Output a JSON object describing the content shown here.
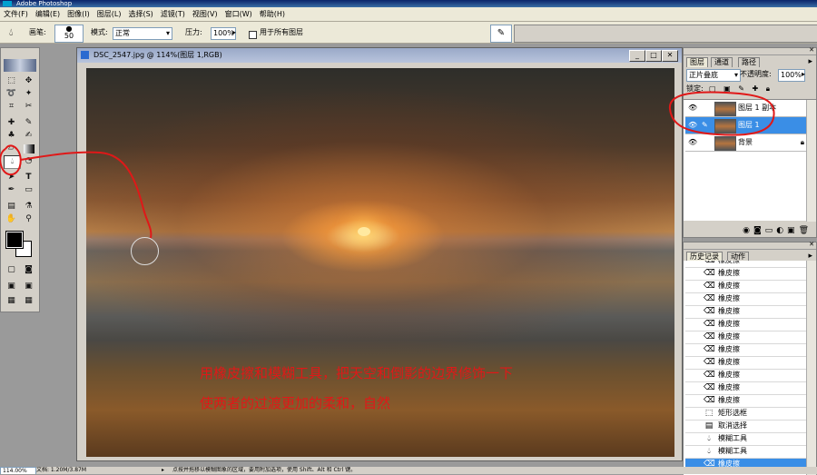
{
  "window": {
    "title": "Adobe Photoshop"
  },
  "menu": [
    "文件(F)",
    "编辑(E)",
    "图像(I)",
    "图层(L)",
    "选择(S)",
    "滤镜(T)",
    "视图(V)",
    "窗口(W)",
    "帮助(H)"
  ],
  "options": {
    "brush_label": "画笔:",
    "brush_size": "50",
    "mode_label": "模式:",
    "mode_value": "正常",
    "pressure_label": "压力:",
    "pressure_value": "100%",
    "all_layers_label": "用于所有图层"
  },
  "document": {
    "title": "DSC_2547.jpg @ 114%(图层 1,RGB)"
  },
  "layers_panel": {
    "tabs": [
      "图层",
      "通道",
      "路径"
    ],
    "blend_mode": "正片叠底",
    "opacity_label": "不透明度:",
    "opacity_value": "100%",
    "lock_label": "锁定:",
    "layers": [
      {
        "name": "图层 1 副本",
        "selected": false
      },
      {
        "name": "图层 1",
        "selected": true
      },
      {
        "name": "背景",
        "selected": false
      }
    ]
  },
  "history_panel": {
    "tabs": [
      "历史记录",
      "动作"
    ],
    "items": [
      {
        "icon": "eraser-icon",
        "label": "橡皮擦"
      },
      {
        "icon": "eraser-icon",
        "label": "橡皮擦"
      },
      {
        "icon": "eraser-icon",
        "label": "橡皮擦"
      },
      {
        "icon": "eraser-icon",
        "label": "橡皮擦"
      },
      {
        "icon": "eraser-icon",
        "label": "橡皮擦"
      },
      {
        "icon": "eraser-icon",
        "label": "橡皮擦"
      },
      {
        "icon": "eraser-icon",
        "label": "橡皮擦"
      },
      {
        "icon": "eraser-icon",
        "label": "橡皮擦"
      },
      {
        "icon": "eraser-icon",
        "label": "橡皮擦"
      },
      {
        "icon": "eraser-icon",
        "label": "橡皮擦"
      },
      {
        "icon": "eraser-icon",
        "label": "橡皮擦"
      },
      {
        "icon": "eraser-icon",
        "label": "橡皮擦"
      },
      {
        "icon": "marquee-icon",
        "label": "矩形选框"
      },
      {
        "icon": "deselect-icon",
        "label": "取消选择"
      },
      {
        "icon": "blur-icon",
        "label": "模糊工具"
      },
      {
        "icon": "blur-icon",
        "label": "模糊工具"
      },
      {
        "icon": "eraser-icon",
        "label": "橡皮擦"
      }
    ]
  },
  "annotation": {
    "line1": "用橡皮擦和模糊工具，把天空和倒影的边界修饰一下",
    "line2": "使两者的过渡更加的柔和，自然"
  },
  "status": {
    "zoom": "114.00%",
    "doc_info": "文档: 1.20M/3.87M",
    "hint": "点按并拖移以模糊图象的区域，要用附加选项，使用 Shift、Alt 和 Ctrl 键。"
  },
  "colors": {
    "annotation": "#e01818",
    "selection": "#3a8ee6"
  }
}
